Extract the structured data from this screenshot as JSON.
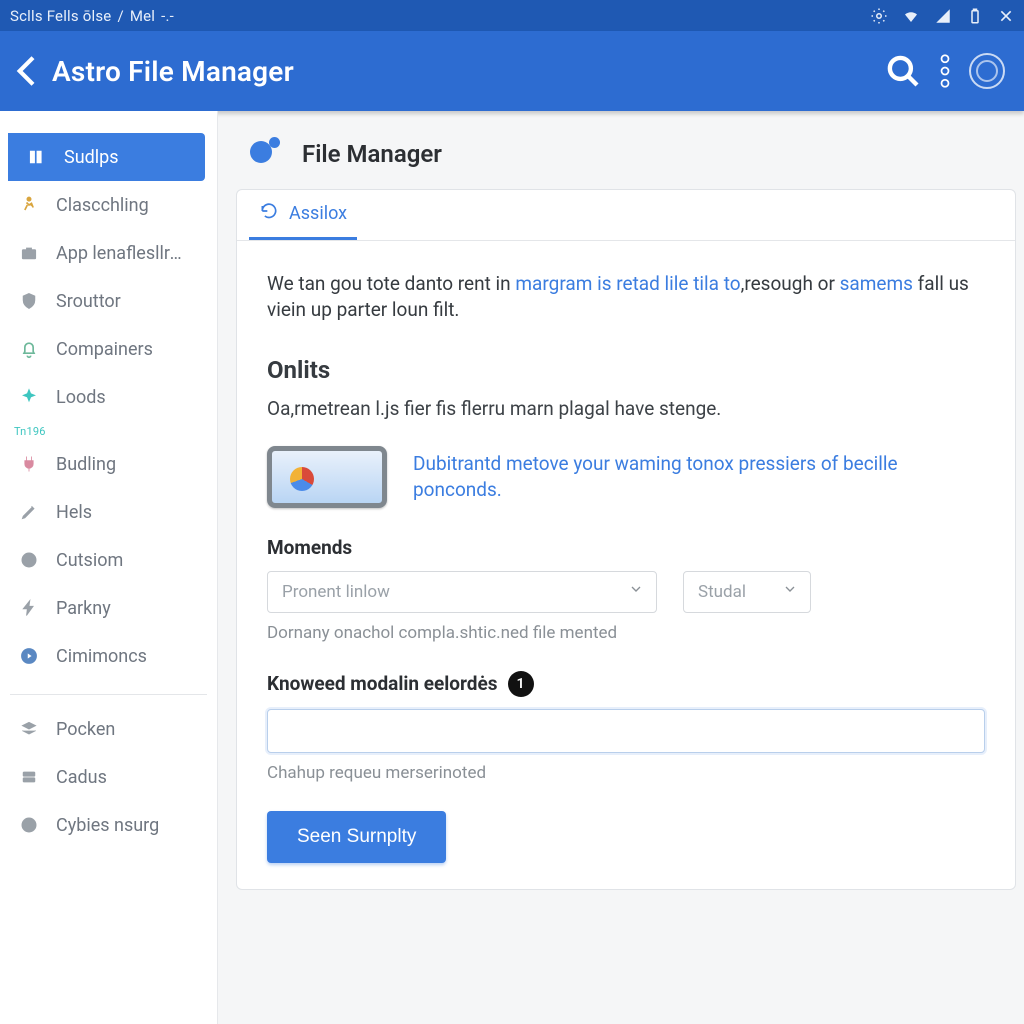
{
  "status_bar": {
    "left": [
      "Sclls Fells ōlse",
      "/",
      "Mel",
      "-.-"
    ]
  },
  "app": {
    "title": "Astro File Manager"
  },
  "sidebar": {
    "items": [
      {
        "label": "Sudlps"
      },
      {
        "label": "Clascchling"
      },
      {
        "label": "App lenaflesllrate"
      },
      {
        "label": "Srouttor"
      },
      {
        "label": "Compainers"
      },
      {
        "label": "Loods"
      },
      {
        "label": "Budling"
      },
      {
        "label": "Hels"
      },
      {
        "label": "Cutsiom"
      },
      {
        "label": "Parkny"
      },
      {
        "label": "Cimimoncs"
      }
    ],
    "mini_label": "Tn196",
    "footer": [
      {
        "label": "Pocken"
      },
      {
        "label": "Cadus"
      },
      {
        "label": "Cybies nsurg"
      }
    ]
  },
  "page": {
    "title": "File Manager",
    "tabs": [
      {
        "label": "Assilox"
      }
    ],
    "intro_parts": {
      "t1": "We tan gou tote danto rent in ",
      "l1": "margram is retad lile tila to",
      "t2": ",resough or ",
      "l2": "samems",
      "t3": " fall us viein up parter loun filt."
    },
    "section1": {
      "heading": "Onlits",
      "sub": "Oa,rmetrean l.js fier fis flerru marn plagal have stenge.",
      "callout": "Dubitrantd metove your waming tonox pressiers of becille ponconds."
    },
    "form": {
      "momends_label": "Momends",
      "select1_placeholder": "Pronent linlow",
      "select2_placeholder": "Studal",
      "select_hint": "Dornany onachol compla.shtic.ned file mented",
      "known_heading": "Knoweed modalin eelordės",
      "known_badge": "1",
      "text_hint": "Chahup requeu merserinoted",
      "submit": "Seen Surnplty"
    }
  },
  "colors": {
    "accent": "#3b7de0",
    "bar": "#2d6cd1",
    "status": "#1f59b3"
  }
}
